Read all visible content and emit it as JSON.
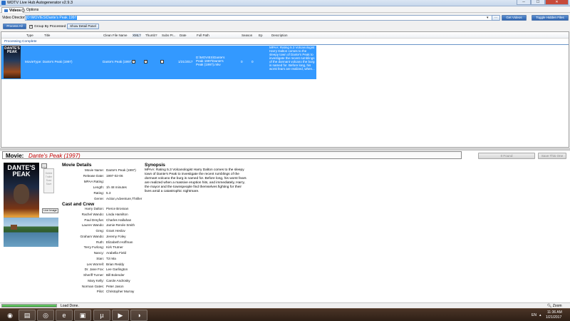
{
  "window": {
    "title": "WDTV Live Hub Autogenerator v2.9.3",
    "min_glyph": "─",
    "max_glyph": "☐",
    "close_glyph": "✕"
  },
  "tabs": [
    {
      "label": "Videos",
      "icon": "videos-icon",
      "active": true
    },
    {
      "label": "Options",
      "icon": "options-icon",
      "active": false
    }
  ],
  "directory": {
    "label": "Video Directory",
    "value": "D:\\MOVIES\\Dante's Peak 1997",
    "get_videos": "Get Videos",
    "toggle_hidden": "Toggle Hidden Files"
  },
  "toolbar": {
    "process_all": "Process All",
    "group_by_processed": "Group By Processed",
    "group_by_checked": true,
    "show_detail_panel": "Show Detail Panel"
  },
  "grid": {
    "columns": [
      "Type",
      "Title",
      "Clean File Name",
      "XML?",
      "Thumb?",
      "Subs Pr...",
      "Date",
      "Full Path",
      "Season",
      "Ep",
      "Description"
    ],
    "group_label": "Processing Complete",
    "rows": [
      {
        "poster_title": "DANTE'S PEAK",
        "type": "",
        "title": "MovieType: Dante's Peak (1997)",
        "clean_file_name": "Dante's Peak (1997)",
        "xml": true,
        "thumb": true,
        "subs": false,
        "date": "1/21/2017",
        "full_path": "D:\\MOVIES\\Dante's Peak 1997\\Dante's Peak (1997).mkv",
        "season": "0",
        "ep": "0",
        "description": "MPAA: Rating 5.3 Volcanologist Harry Dalton comes to the sleepy town of Dante's Peak to investigate the recent rumblings of the dormant volcano the burg is named for. Before long, his worst fears are realized, when..."
      }
    ]
  },
  "detail": {
    "movie_label": "Movie:",
    "movie_name": "Dante's Peak (1997)",
    "poster_title": "DANTE'S PEAK",
    "thumb_button": "...",
    "scrape_button": "Delete Trailer Scan Save",
    "live_image": "Live Image",
    "details_title": "Movie Details",
    "details": [
      {
        "label": "Movie Name:",
        "value": "Dante's Peak (1997)"
      },
      {
        "label": "Release Date:",
        "value": "1997-02-06"
      },
      {
        "label": "MPAA Rating:",
        "value": ""
      },
      {
        "label": "Length:",
        "value": "1h 48 minutes"
      },
      {
        "label": "Rating:",
        "value": "5.3"
      },
      {
        "label": "Genre:",
        "value": "Action,Adventure,Thriller"
      }
    ],
    "cast_title": "Cast and Crew",
    "cast": [
      {
        "role": "Harry Dalton:",
        "actor": "Pierce Brosnan"
      },
      {
        "role": "Rachel Wando:",
        "actor": "Linda Hamilton"
      },
      {
        "role": "Paul Dreyfus:",
        "actor": "Charles Hallahan"
      },
      {
        "role": "Lauren Wando:",
        "actor": "Jamie Renée Smith"
      },
      {
        "role": "Greg:",
        "actor": "Grant Heslov"
      },
      {
        "role": "Graham Wando:",
        "actor": "Jeremy Foley"
      },
      {
        "role": "Ruth:",
        "actor": "Elizabeth Hoffman"
      },
      {
        "role": "Terry Furlong:",
        "actor": "Kirk Trutner"
      },
      {
        "role": "Nancy:",
        "actor": "Arabella Field"
      },
      {
        "role": "Stan:",
        "actor": "Tzi Ma"
      },
      {
        "role": "Les Worrell:",
        "actor": "Brian Reddy"
      },
      {
        "role": "Dr. Jane Fox:",
        "actor": "Lee Garlington"
      },
      {
        "role": "Sheriff Turner:",
        "actor": "Bill Bolender"
      },
      {
        "role": "Mary Kelly:",
        "actor": "Carole Androsky"
      },
      {
        "role": "Norman Gates:",
        "actor": "Peter Jason"
      },
      {
        "role": "Pilot:",
        "actor": "Christopher Murray"
      }
    ],
    "synopsis_title": "Synopsis",
    "synopsis": "MPAA: Rating 5.3 Volcanologist Harry Dalton comes to the sleepy town of Dante's Peak to investigate the recent rumblings of the dormant volcano the burg is named for. Before long, his worst fears are realized when a massive eruption hits, and immediately, Harry, the mayor and the townspeople find themselves fighting for their lives amid a catastrophic nightmare.",
    "found_button": "0 Found",
    "save_button": "Save This One"
  },
  "status": {
    "text": "Load Done.",
    "progress": 1.0,
    "zoom": "Zoom"
  },
  "taskbar": {
    "apps": [
      {
        "icon": "start-orb-icon",
        "glyph": "◉"
      },
      {
        "icon": "explorer-icon",
        "glyph": "▤"
      },
      {
        "icon": "chrome-icon",
        "glyph": "◎"
      },
      {
        "icon": "internet-explorer-icon",
        "glyph": "e"
      },
      {
        "icon": "autogenerator-icon",
        "glyph": "▣"
      },
      {
        "icon": "utorrent-icon",
        "glyph": "µ"
      },
      {
        "icon": "media-player-icon",
        "glyph": "▶"
      },
      {
        "icon": "settings-app-icon",
        "glyph": "◑"
      }
    ],
    "language": "EN",
    "time": "11:36 AM",
    "date": "1/21/2017"
  }
}
